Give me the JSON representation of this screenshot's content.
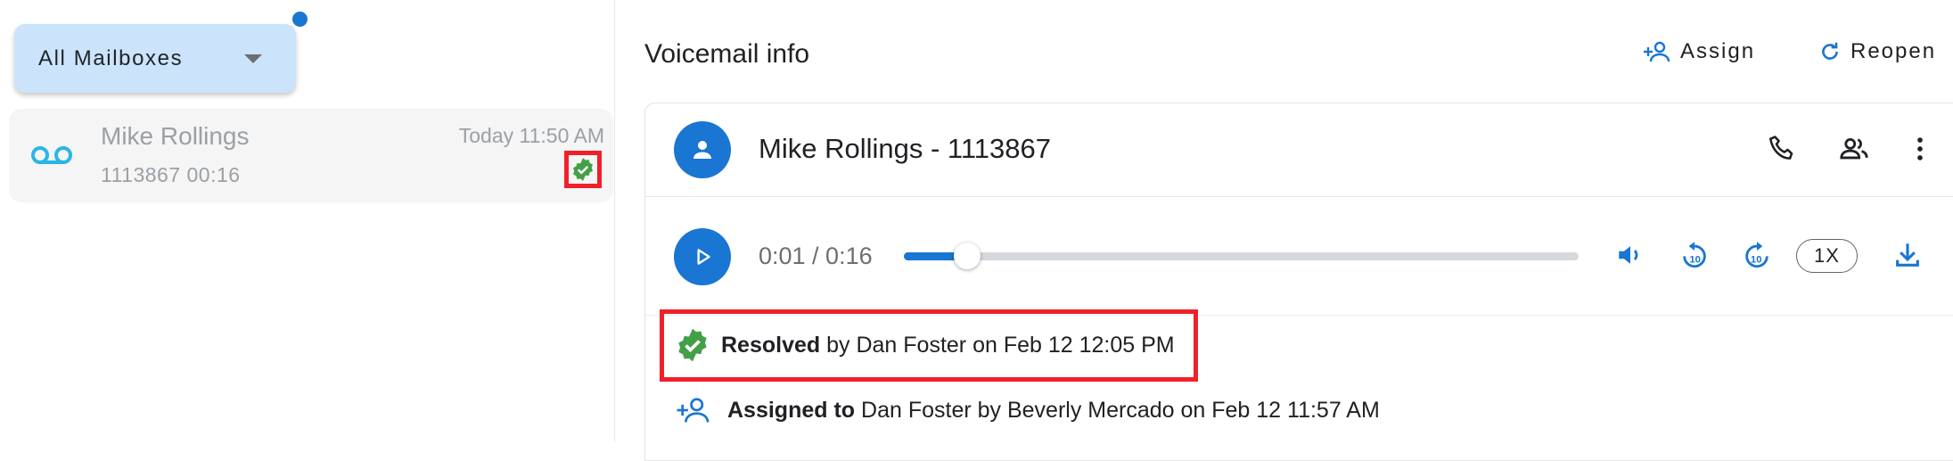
{
  "sidebar": {
    "mailbox_selector": "All Mailboxes",
    "voicemail_item": {
      "name": "Mike Rollings",
      "subtitle": "1113867 00:16",
      "time": "Today 11:50 AM",
      "status_icon": "verified-check-icon"
    }
  },
  "header": {
    "title": "Voicemail info",
    "assign_label": "Assign",
    "reopen_label": "Reopen"
  },
  "contact": {
    "display": "Mike Rollings - 1113867"
  },
  "player": {
    "timecode": "0:01 / 0:16",
    "progress_fraction": 0.094,
    "speed": "1X"
  },
  "history": {
    "resolved_bold": "Resolved",
    "resolved_rest": " by Dan Foster on Feb 12 12:05 PM",
    "assigned_bold": "Assigned to",
    "assigned_rest": " Dan Foster by Beverly Mercado on Feb 12 11:57 AM"
  },
  "colors": {
    "accent": "#1976d2",
    "voicemail_icon": "#29b6e6",
    "resolved_green": "#43a047",
    "highlight_red": "#f0202a"
  }
}
